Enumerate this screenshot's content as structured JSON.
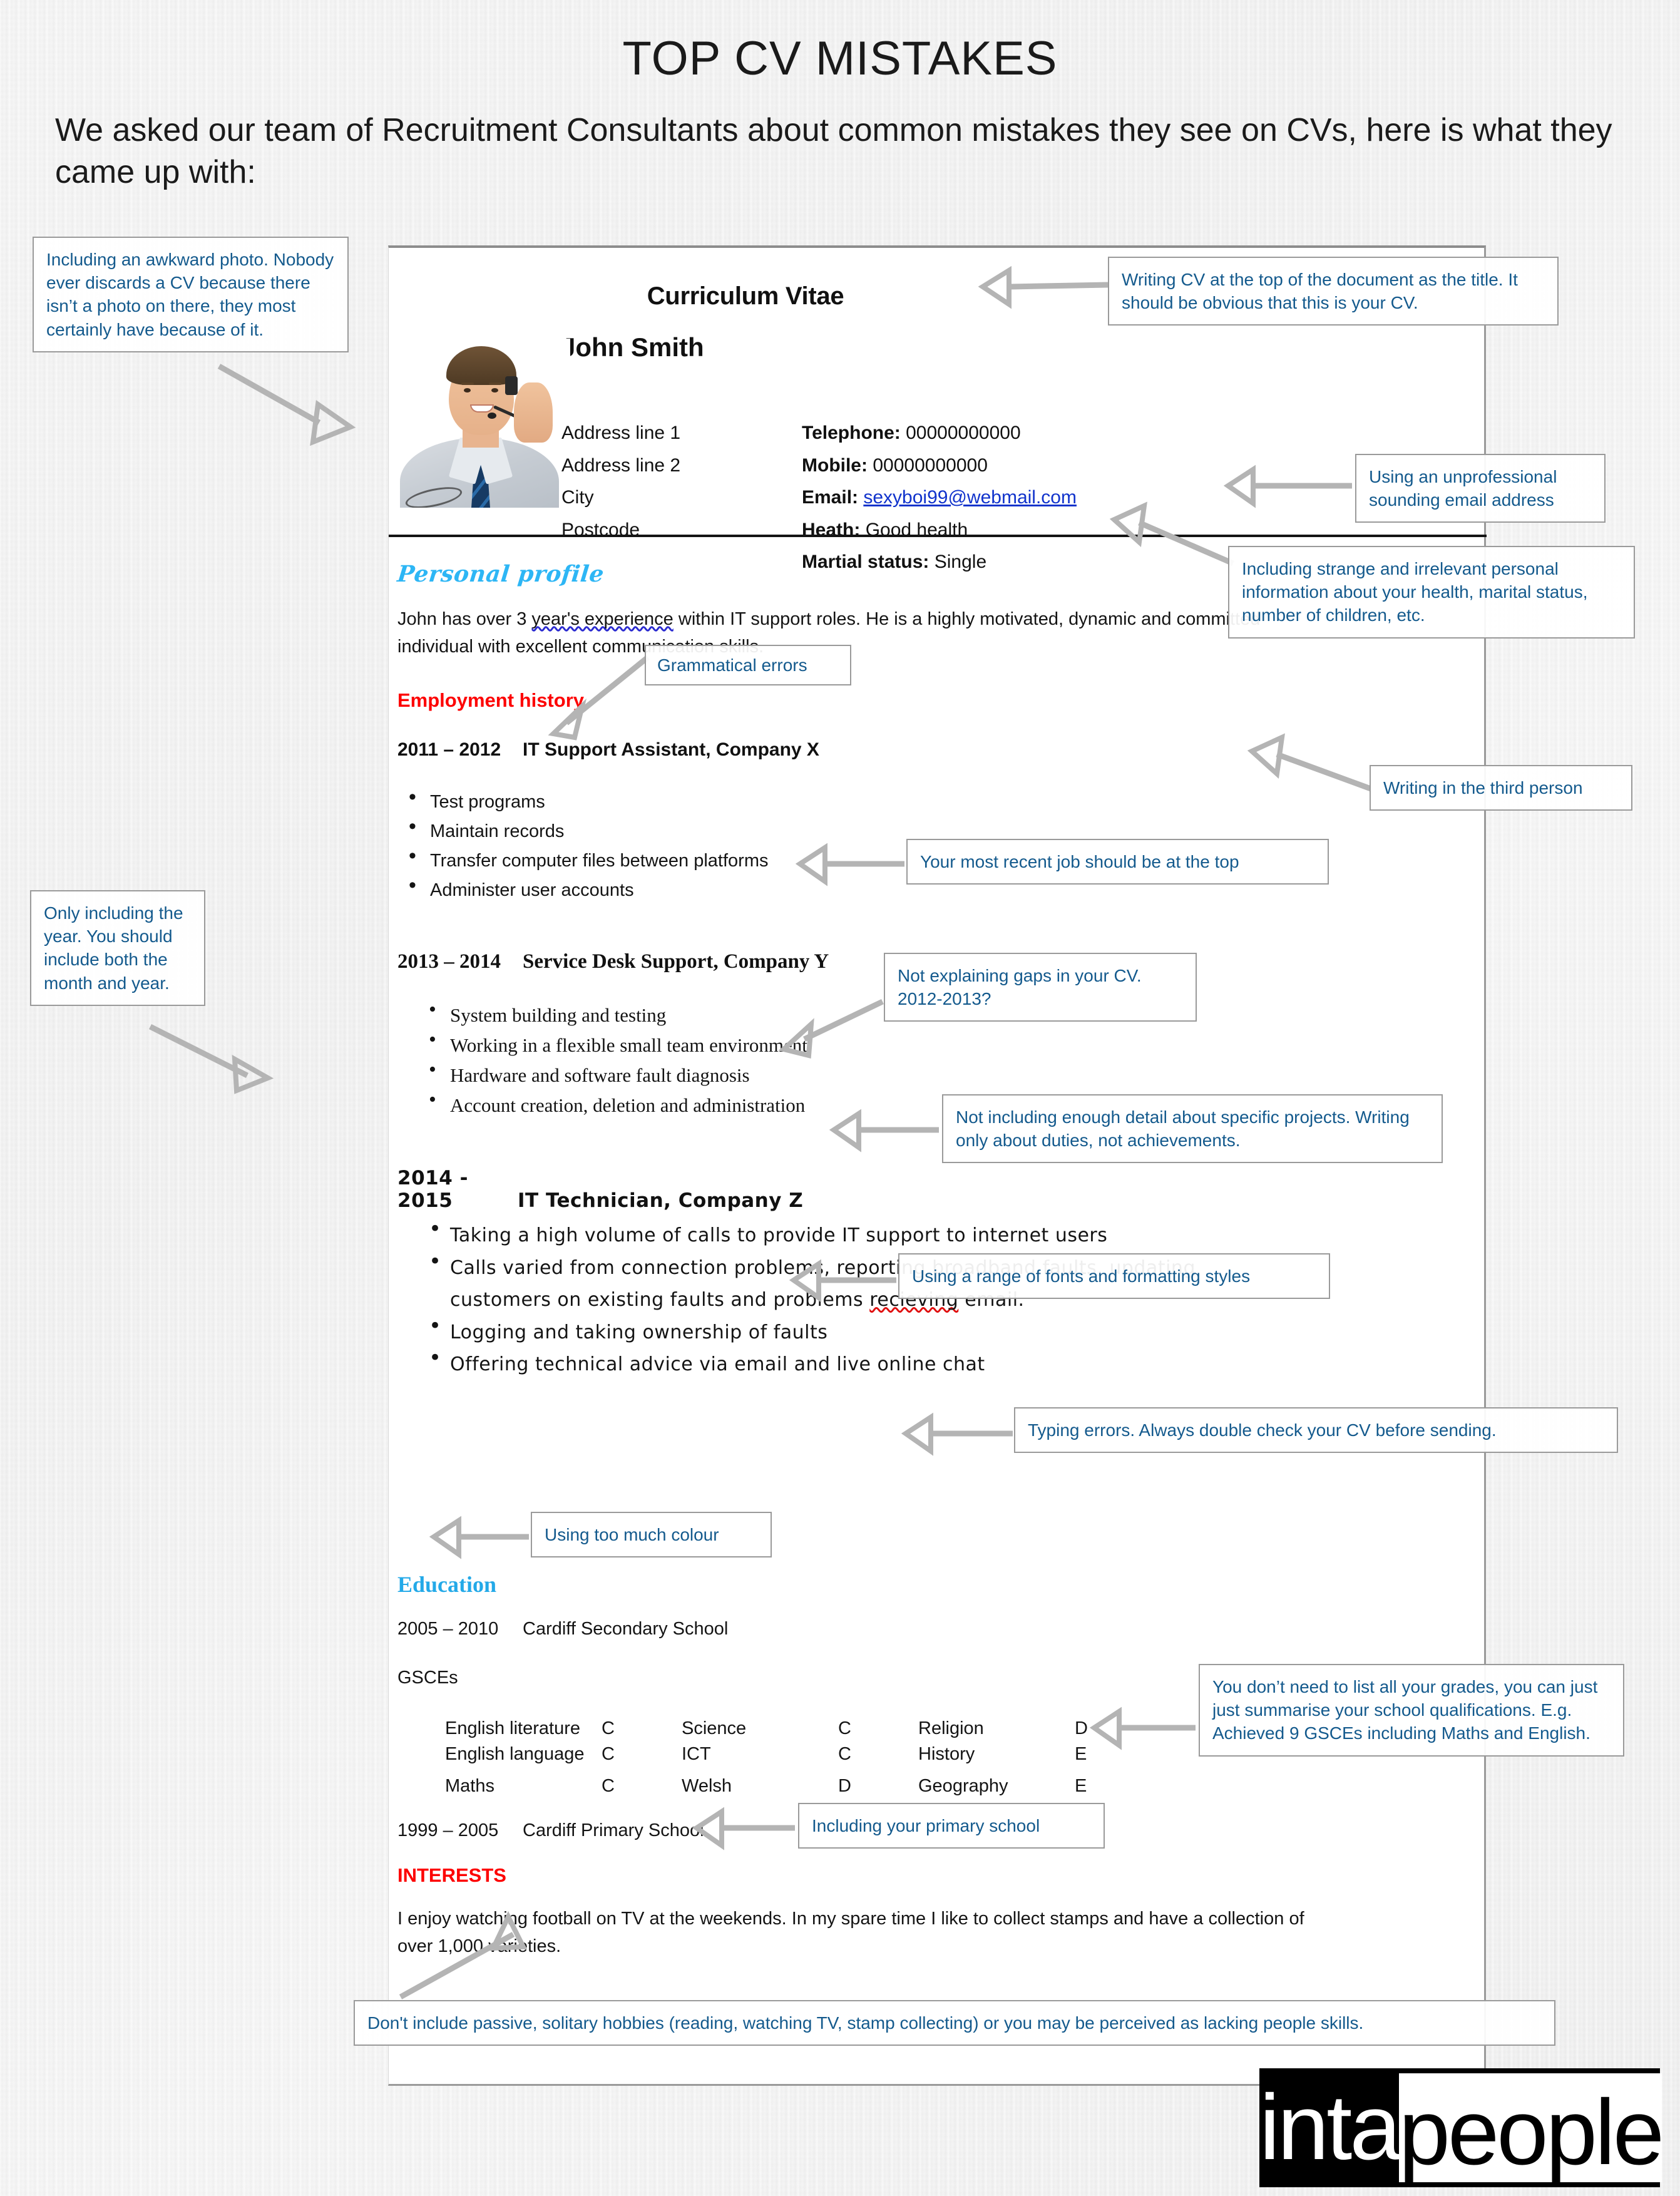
{
  "header": {
    "title": "TOP CV MISTAKES",
    "subtitle": "We asked our team of Recruitment Consultants about common mistakes they see on CVs, here is what they came up with:"
  },
  "cv": {
    "document_title": "Curriculum Vitae",
    "name": "John Smith",
    "photo_alt": "smiling man wearing a call-centre headset",
    "address": [
      "Address line 1",
      "Address line 2",
      "City",
      "Postcode"
    ],
    "contact": [
      {
        "label": "Telephone:",
        "value": "00000000000",
        "link": false
      },
      {
        "label": "Mobile:",
        "value": "00000000000",
        "link": false
      },
      {
        "label": "Email:",
        "value": "sexyboi99@webmail.com",
        "link": true
      },
      {
        "label": "Heath:",
        "value": "Good health",
        "link": false
      },
      {
        "label": "Martial status:",
        "value": "Single",
        "link": false
      }
    ],
    "personal_profile": {
      "heading": "Personal profile",
      "text_before": "John has over 3 ",
      "text_error": "year's experience",
      "text_after": " within IT support roles. He is a highly motivated, dynamic and committed individual with excellent communication skills."
    },
    "employment": {
      "heading": "Employment history",
      "jobs": [
        {
          "dates": "2011 – 2012",
          "title": "IT Support Assistant, Company X",
          "bullets": [
            "Test programs",
            "Maintain records",
            "Transfer computer files between platforms",
            "Administer user accounts"
          ]
        },
        {
          "dates": "2013 – 2014",
          "title": "Service Desk Support, Company Y",
          "bullets": [
            "System building and testing",
            "Working in a flexible small team environment",
            "Hardware and software fault diagnosis",
            "Account creation, deletion and administration"
          ]
        },
        {
          "dates": "2014 - 2015",
          "title": "IT Technician,  Company Z",
          "bullets": [
            "Taking a high volume of calls to provide IT support to internet users",
            "Calls varied from connection problems, reporting broadband faults, updating customers on existing faults and problems recieving email.",
            "Logging and taking ownership of faults",
            "Offering technical advice via email and live online chat"
          ],
          "typo_word": "recieving"
        }
      ]
    },
    "education": {
      "heading": "Education",
      "secondary": {
        "dates": "2005 – 2010",
        "school": "Cardiff Secondary School"
      },
      "qualification_label": "GSCEs",
      "grades": [
        [
          {
            "subject": "English literature",
            "grade": "C"
          },
          {
            "subject": "Science",
            "grade": "C"
          },
          {
            "subject": "Religion",
            "grade": "D"
          }
        ],
        [
          {
            "subject": "English language",
            "grade": "C"
          },
          {
            "subject": "ICT",
            "grade": "C"
          },
          {
            "subject": "History",
            "grade": "E"
          }
        ],
        [
          {
            "subject": "Maths",
            "grade": "C"
          },
          {
            "subject": "Welsh",
            "grade": "D"
          },
          {
            "subject": "Geography",
            "grade": "E"
          }
        ]
      ],
      "primary": {
        "dates": "1999 – 2005",
        "school": "Cardiff Primary School"
      }
    },
    "interests": {
      "heading": "INTERESTS",
      "text": "I enjoy watching football on TV at the weekends. In my spare time I like to collect stamps and have a collection of over 1,000 varieties."
    }
  },
  "annotations": [
    {
      "id": "photo",
      "text": "Including an awkward photo. Nobody ever discards a CV because there isn’t a photo on there, they most certainly have because of it."
    },
    {
      "id": "cv-title",
      "text": "Writing CV at the top of the document as the title. It should be obvious that this is your CV."
    },
    {
      "id": "email",
      "text": "Using an unprofessional sounding email address"
    },
    {
      "id": "personal-info",
      "text": "Including strange and irrelevant personal information about your health, marital status, number of children, etc."
    },
    {
      "id": "grammar",
      "text": "Grammatical errors"
    },
    {
      "id": "third-person",
      "text": "Writing in the third person"
    },
    {
      "id": "recent-job",
      "text": "Your most recent job should be at the top"
    },
    {
      "id": "month-year",
      "text": "Only including the year. You should include both the month and year."
    },
    {
      "id": "gaps",
      "text": "Not explaining gaps in your CV. 2012-2013?"
    },
    {
      "id": "detail",
      "text": "Not including enough detail about specific projects. Writing only about duties, not achievements."
    },
    {
      "id": "fonts",
      "text": "Using a range of fonts and formatting styles"
    },
    {
      "id": "typing",
      "text": "Typing errors. Always double check your CV before sending."
    },
    {
      "id": "colour",
      "text": "Using too much colour"
    },
    {
      "id": "grades",
      "text": "You don’t need to list all your grades, you can just  just summarise your school qualifications. E.g. Achieved 9 GSCEs including Maths and English."
    },
    {
      "id": "primary",
      "text": "Including your primary school"
    },
    {
      "id": "hobbies",
      "text": "Don't include passive, solitary hobbies (reading, watching TV, stamp collecting) or you may be perceived as lacking people skills."
    }
  ],
  "logo": {
    "part1": "inta",
    "part2": "people"
  },
  "colors": {
    "annotation_text": "#145a8d",
    "arrow": "#b4b4b4",
    "heading_red": "#fd0000",
    "heading_cyan": "#2db6f5",
    "heading_blue": "#23a9e8",
    "email_link": "#1133cc"
  }
}
